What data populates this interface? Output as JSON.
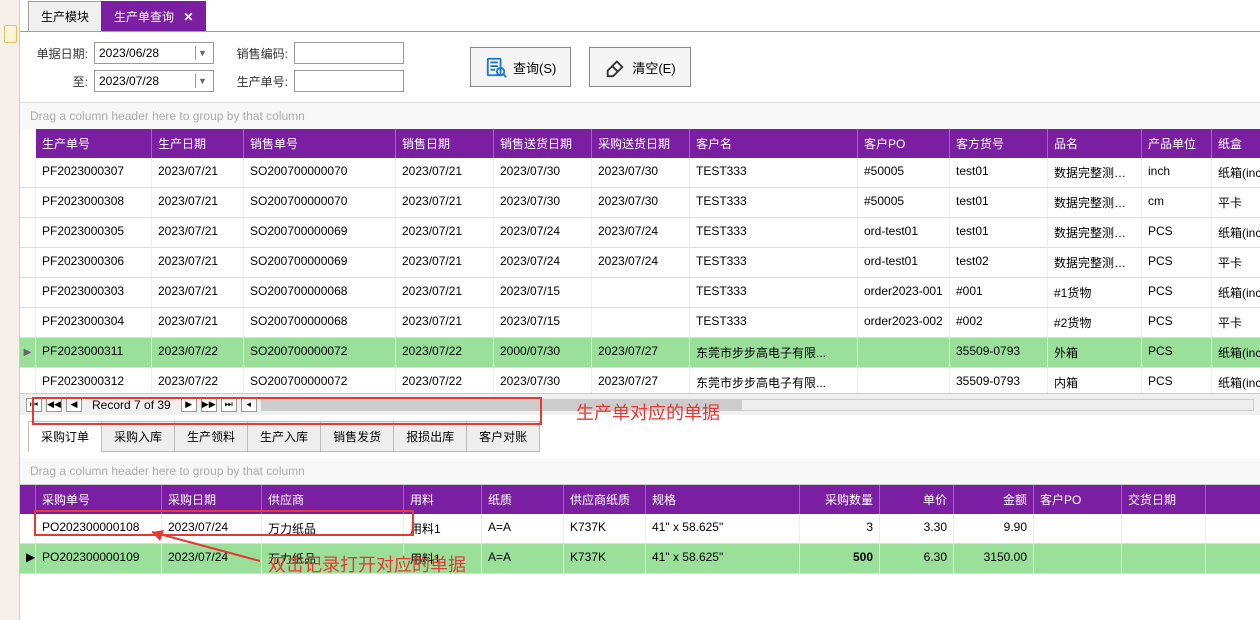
{
  "tabs": {
    "main": "生产模块",
    "query": "生产单查询"
  },
  "filter": {
    "dateLabel": "单据日期:",
    "dateFrom": "2023/06/28",
    "toLabel": "至:",
    "dateTo": "2023/07/28",
    "saleCodeLabel": "销售编码:",
    "saleCodeVal": "",
    "prodNoLabel": "生产单号:",
    "prodNoVal": "",
    "queryBtn": "查询(S)",
    "clearBtn": "清空(E)"
  },
  "groupHint": "Drag a column header here to group by that column",
  "cols": {
    "pfno": "生产单号",
    "pfdate": "生产日期",
    "sono": "销售单号",
    "sodate": "销售日期",
    "shipdate": "销售送货日期",
    "purdate": "采购送货日期",
    "cust": "客户名",
    "custpo": "客户PO",
    "custpart": "客方货号",
    "item": "品名",
    "unit": "产品单位",
    "box": "纸盒"
  },
  "rows": [
    {
      "pfno": "PF2023000307",
      "pfdate": "2023/07/21",
      "sono": "SO200700000070",
      "sodate": "2023/07/21",
      "shipdate": "2023/07/30",
      "purdate": "2023/07/30",
      "cust": "TEST333",
      "custpo": "#50005",
      "custpart": "test01",
      "item": "数据完整测试-...",
      "unit": "inch",
      "box": "纸箱(inch)"
    },
    {
      "pfno": "PF2023000308",
      "pfdate": "2023/07/21",
      "sono": "SO200700000070",
      "sodate": "2023/07/21",
      "shipdate": "2023/07/30",
      "purdate": "2023/07/30",
      "cust": "TEST333",
      "custpo": "#50005",
      "custpart": "test01",
      "item": "数据完整测试-...",
      "unit": "cm",
      "box": "平卡"
    },
    {
      "pfno": "PF2023000305",
      "pfdate": "2023/07/21",
      "sono": "SO200700000069",
      "sodate": "2023/07/21",
      "shipdate": "2023/07/24",
      "purdate": "2023/07/24",
      "cust": "TEST333",
      "custpo": "ord-test01",
      "custpart": "test01",
      "item": "数据完整测试-...",
      "unit": "PCS",
      "box": "纸箱(inch)"
    },
    {
      "pfno": "PF2023000306",
      "pfdate": "2023/07/21",
      "sono": "SO200700000069",
      "sodate": "2023/07/21",
      "shipdate": "2023/07/24",
      "purdate": "2023/07/24",
      "cust": "TEST333",
      "custpo": "ord-test01",
      "custpart": "test02",
      "item": "数据完整测试-...",
      "unit": "PCS",
      "box": "平卡"
    },
    {
      "pfno": "PF2023000303",
      "pfdate": "2023/07/21",
      "sono": "SO200700000068",
      "sodate": "2023/07/21",
      "shipdate": "2023/07/15",
      "purdate": "",
      "cust": "TEST333",
      "custpo": "order2023-001",
      "custpart": "#001",
      "item": "#1货物",
      "unit": "PCS",
      "box": "纸箱(inch)"
    },
    {
      "pfno": "PF2023000304",
      "pfdate": "2023/07/21",
      "sono": "SO200700000068",
      "sodate": "2023/07/21",
      "shipdate": "2023/07/15",
      "purdate": "",
      "cust": "TEST333",
      "custpo": "order2023-002",
      "custpart": "#002",
      "item": "#2货物",
      "unit": "PCS",
      "box": "平卡"
    },
    {
      "sel": true,
      "pfno": "PF2023000311",
      "pfdate": "2023/07/22",
      "sono": "SO200700000072",
      "sodate": "2023/07/22",
      "shipdate": "2000/07/30",
      "purdate": "2023/07/27",
      "cust": "东莞市步步高电子有限...",
      "custpo": "",
      "custpart": "35509-0793",
      "item": "外箱",
      "unit": "PCS",
      "box": "纸箱(inch)"
    },
    {
      "pfno": "PF2023000312",
      "pfdate": "2023/07/22",
      "sono": "SO200700000072",
      "sodate": "2023/07/22",
      "shipdate": "2023/07/30",
      "purdate": "2023/07/27",
      "cust": "东莞市步步高电子有限...",
      "custpo": "",
      "custpart": "35509-0793",
      "item": "内箱",
      "unit": "PCS",
      "box": "纸箱(inch)"
    }
  ],
  "pager": {
    "text": "Record 7 of 39"
  },
  "subTabs": {
    "t0": "采购订单",
    "t1": "采购入库",
    "t2": "生产领料",
    "t3": "生产入库",
    "t4": "销售发货",
    "t5": "报损出库",
    "t6": "客户对账"
  },
  "annot": {
    "tabs": "生产单对应的单据",
    "row": "双击记录打开对应的单据"
  },
  "dcols": {
    "pono": "采购单号",
    "podate": "采购日期",
    "supp": "供应商",
    "mat": "用料",
    "paper": "纸质",
    "spaper": "供应商纸质",
    "spec": "规格",
    "qty": "采购数量",
    "price": "单价",
    "amt": "金额",
    "cpo": "客户PO",
    "ddate": "交货日期"
  },
  "drows": [
    {
      "pono": "PO202300000108",
      "podate": "2023/07/24",
      "supp": "万力纸品",
      "mat": "用料1",
      "paper": "A=A",
      "spaper": "K737K",
      "spec": "41\" x 58.625\"",
      "qty": "3",
      "price": "3.30",
      "amt": "9.90",
      "cpo": "",
      "ddate": ""
    },
    {
      "sel": true,
      "pono": "PO202300000109",
      "podate": "2023/07/24",
      "supp": "万力纸品",
      "mat": "用料1",
      "paper": "A=A",
      "spaper": "K737K",
      "spec": "41\" x 58.625\"",
      "qty": "500",
      "price": "6.30",
      "amt": "3150.00",
      "cpo": "",
      "ddate": ""
    }
  ]
}
